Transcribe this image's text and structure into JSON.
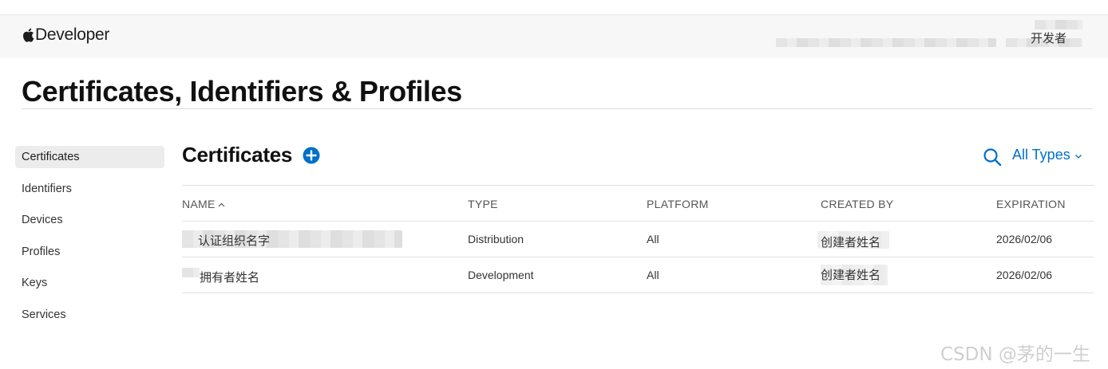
{
  "header": {
    "brand_text": "Developer",
    "account_label": "开发者"
  },
  "page": {
    "title": "Certificates, Identifiers & Profiles"
  },
  "sidebar": {
    "items": [
      {
        "label": "Certificates",
        "active": true
      },
      {
        "label": "Identifiers"
      },
      {
        "label": "Devices"
      },
      {
        "label": "Profiles"
      },
      {
        "label": "Keys"
      },
      {
        "label": "Services"
      }
    ]
  },
  "section": {
    "title": "Certificates",
    "filter_label": "All Types"
  },
  "table": {
    "columns": [
      "NAME",
      "TYPE",
      "PLATFORM",
      "CREATED BY",
      "EXPIRATION"
    ],
    "rows": [
      {
        "name": "认证组织名字",
        "type": "Distribution",
        "platform": "All",
        "created_by": "创建者姓名",
        "expiration": "2026/02/06"
      },
      {
        "name": "拥有者姓名",
        "type": "Development",
        "platform": "All",
        "created_by": "创建者姓名",
        "expiration": "2026/02/06"
      }
    ]
  },
  "watermark": "CSDN @茅的一生",
  "colors": {
    "accent": "#0070c9",
    "header_bg": "#f7f7f7",
    "active_item_bg": "#ececec"
  }
}
